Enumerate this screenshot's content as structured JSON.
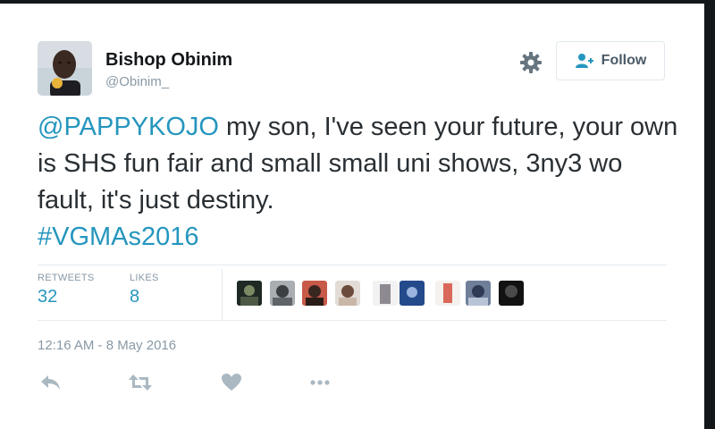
{
  "author": {
    "display_name": "Bishop Obinim",
    "handle": "@Obinim_"
  },
  "header": {
    "follow_label": "Follow",
    "settings_icon": "gear-icon"
  },
  "tweet": {
    "mention": "@PAPPYKOJO",
    "text": " my son, I've seen your future, your own is SHS fun fair and small small uni shows, 3ny3 wo fault, it's just destiny.",
    "hashtag": "#VGMAs2016"
  },
  "stats": {
    "retweets_label": "RETWEETS",
    "retweets_count": "32",
    "likes_label": "LIKES",
    "likes_count": "8",
    "liker_avatar_count": 9
  },
  "timestamp": "12:16 AM - 8 May 2016",
  "actions": [
    "reply-icon",
    "retweet-icon",
    "like-icon",
    "more-icon"
  ],
  "colors": {
    "link": "#2596be",
    "muted": "#8899a6",
    "text": "#292f33"
  }
}
